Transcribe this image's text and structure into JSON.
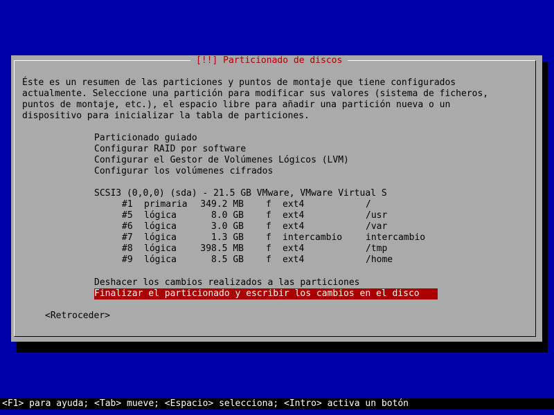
{
  "dialog": {
    "title": "[!!] Particionado de discos",
    "description": [
      "Éste es un resumen de las particiones y puntos de montaje que tiene configurados",
      "actualmente. Seleccione una partición para modificar sus valores (sistema de ficheros,",
      "puntos de montaje, etc.), el espacio libre para añadir una partición nueva o un",
      "dispositivo para inicializar la tabla de particiones."
    ],
    "menu": [
      "Particionado guiado",
      "Configurar RAID por software",
      "Configurar el Gestor de Volúmenes Lógicos (LVM)",
      "Configurar los volúmenes cifrados"
    ],
    "disk": "SCSI3 (0,0,0) (sda) - 21.5 GB VMware, VMware Virtual S",
    "partitions": [
      {
        "num": "#1",
        "type": "primaria",
        "size": "349.2 MB",
        "flag": "f",
        "fs": "ext4",
        "mount": "/"
      },
      {
        "num": "#5",
        "type": "lógica",
        "size": "8.0 GB",
        "flag": "f",
        "fs": "ext4",
        "mount": "/usr"
      },
      {
        "num": "#6",
        "type": "lógica",
        "size": "3.0 GB",
        "flag": "f",
        "fs": "ext4",
        "mount": "/var"
      },
      {
        "num": "#7",
        "type": "lógica",
        "size": "1.3 GB",
        "flag": "f",
        "fs": "intercambio",
        "mount": "intercambio"
      },
      {
        "num": "#8",
        "type": "lógica",
        "size": "398.5 MB",
        "flag": "f",
        "fs": "ext4",
        "mount": "/tmp"
      },
      {
        "num": "#9",
        "type": "lógica",
        "size": "8.5 GB",
        "flag": "f",
        "fs": "ext4",
        "mount": "/home"
      }
    ],
    "undo_changes": "Deshacer los cambios realizados a las particiones",
    "finish": "Finalizar el particionado y escribir los cambios en el disco",
    "back_button": "<Retroceder>"
  },
  "statusbar": "<F1> para ayuda; <Tab> mueve; <Espacio> selecciona; <Intro> activa un botón",
  "colors": {
    "background": "#0000aa",
    "dialog": "#aaaaaa",
    "title": "#aa0000",
    "selection": "#aa0000",
    "selection_text": "#ffffff"
  }
}
